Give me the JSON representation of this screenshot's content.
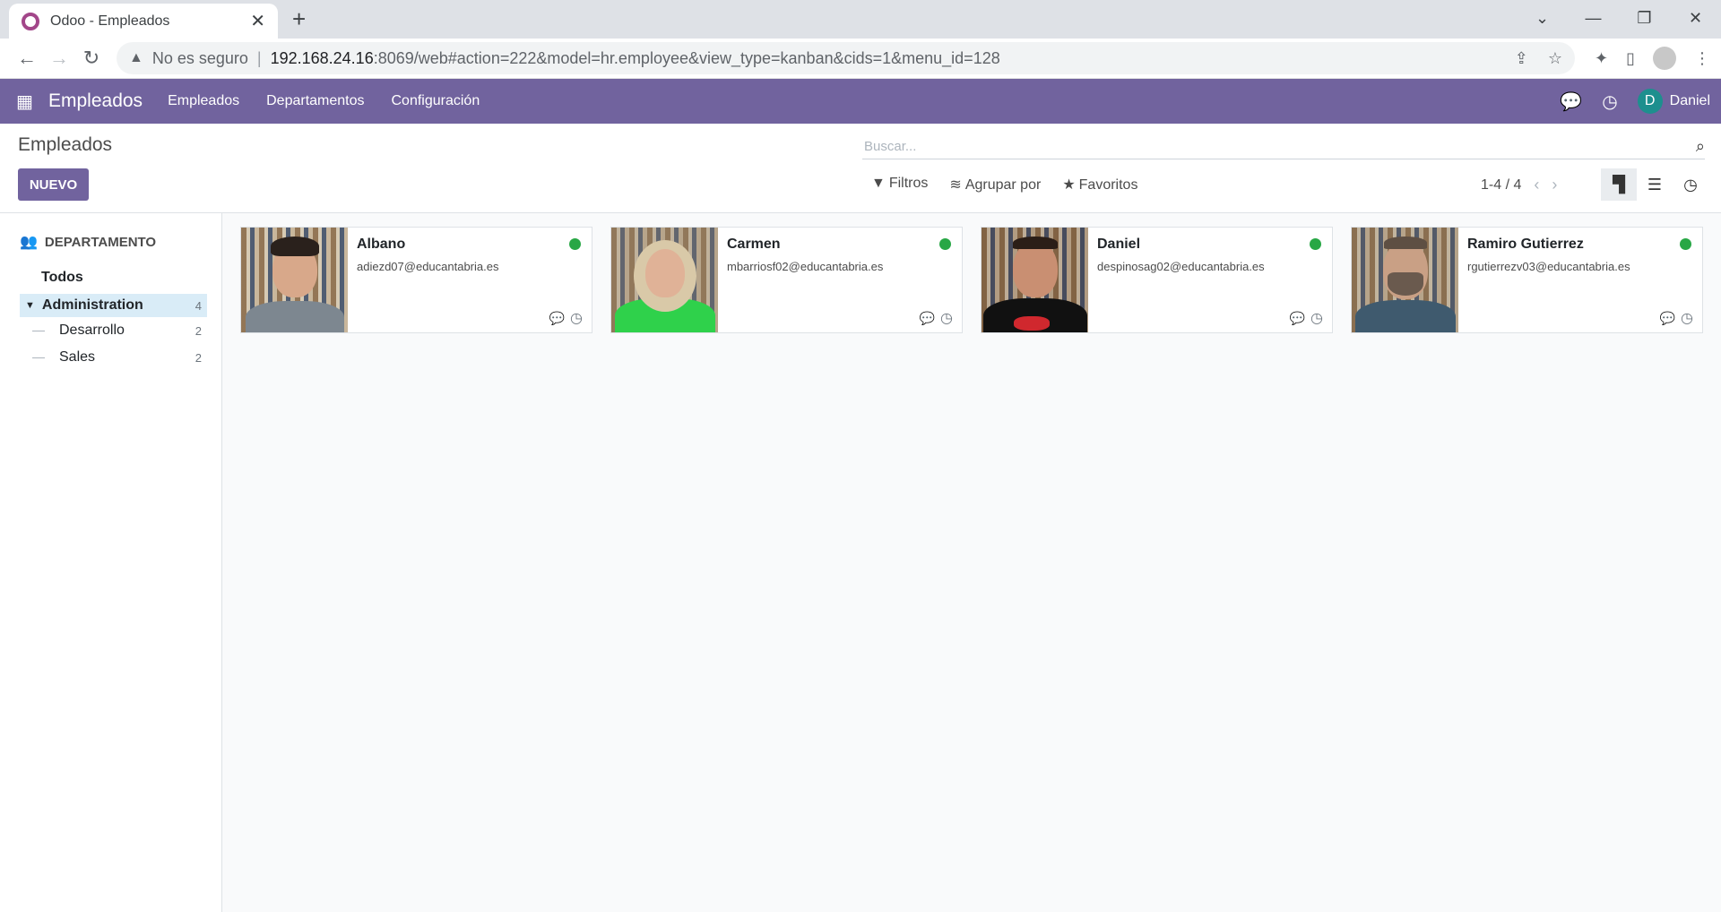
{
  "browser": {
    "tab_title": "Odoo - Empleados",
    "not_secure": "No es seguro",
    "url_host": "192.168.24.16",
    "url_rest": ":8069/web#action=222&model=hr.employee&view_type=kanban&cids=1&menu_id=128"
  },
  "navbar": {
    "brand": "Empleados",
    "menu": [
      "Empleados",
      "Departamentos",
      "Configuración"
    ],
    "user_initial": "D",
    "user_name": "Daniel"
  },
  "control_panel": {
    "title": "Empleados",
    "new_button": "NUEVO",
    "search_placeholder": "Buscar...",
    "filters": "Filtros",
    "group_by": "Agrupar por",
    "favorites": "Favoritos",
    "pager": "1-4 / 4"
  },
  "side_panel": {
    "header": "DEPARTAMENTO",
    "all": "Todos",
    "root": {
      "name": "Administration",
      "count": "4"
    },
    "children": [
      {
        "name": "Desarrollo",
        "count": "2"
      },
      {
        "name": "Sales",
        "count": "2"
      }
    ]
  },
  "employees": [
    {
      "name": "Albano",
      "email": "adiezd07@educantabria.es",
      "status_color": "#28a745"
    },
    {
      "name": "Carmen",
      "email": "mbarriosf02@educantabria.es",
      "status_color": "#28a745"
    },
    {
      "name": "Daniel",
      "email": "despinosag02@educantabria.es",
      "status_color": "#28a745"
    },
    {
      "name": "Ramiro Gutierrez",
      "email": "rgutierrezv03@educantabria.es",
      "status_color": "#28a745"
    }
  ],
  "colors": {
    "brand": "#71639e",
    "presence": "#28a745"
  }
}
